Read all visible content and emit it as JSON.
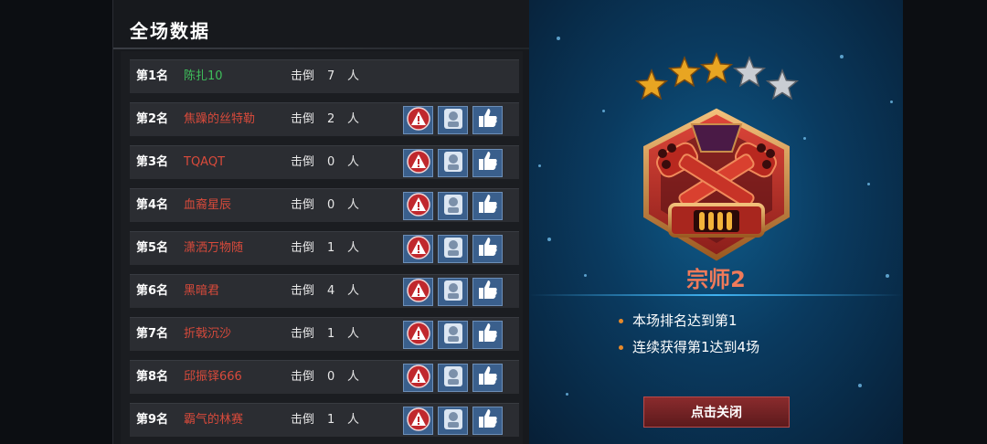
{
  "scoreboard": {
    "title": "全场数据",
    "kill_label": "击倒",
    "unit": "人",
    "rows": [
      {
        "rank": "第1名",
        "name": "陈扎10",
        "kills": "7",
        "name_color": "#3fbf5b",
        "actions": false
      },
      {
        "rank": "第2名",
        "name": "焦躁的丝特勒",
        "kills": "2",
        "name_color": "#d84a3b",
        "actions": true
      },
      {
        "rank": "第3名",
        "name": "TQAQT",
        "kills": "0",
        "name_color": "#d84a3b",
        "actions": true
      },
      {
        "rank": "第4名",
        "name": "血裔星辰",
        "kills": "0",
        "name_color": "#d84a3b",
        "actions": true
      },
      {
        "rank": "第5名",
        "name": "潇洒万物随",
        "kills": "1",
        "name_color": "#d84a3b",
        "actions": true
      },
      {
        "rank": "第6名",
        "name": "黑暗君",
        "kills": "4",
        "name_color": "#d84a3b",
        "actions": true
      },
      {
        "rank": "第7名",
        "name": "折戟沉沙",
        "kills": "1",
        "name_color": "#d84a3b",
        "actions": true
      },
      {
        "rank": "第8名",
        "name": "邱振铎666",
        "kills": "0",
        "name_color": "#d84a3b",
        "actions": true
      },
      {
        "rank": "第9名",
        "name": "霸气的林赛",
        "kills": "1",
        "name_color": "#d84a3b",
        "actions": true
      }
    ],
    "icons": {
      "report": "warning-icon",
      "profile": "profile-icon",
      "like": "thumbs-up-icon"
    }
  },
  "rank_panel": {
    "rank_title": "宗师2",
    "stars_filled": 3,
    "stars_total": 5,
    "achievements": [
      "本场排名达到第1",
      "连续获得第1达到4场"
    ],
    "close_label": "点击关闭"
  },
  "colors": {
    "first_place_name": "#3fbf5b",
    "other_name": "#d84a3b",
    "rank_title": "#f07a5a",
    "button_blue": "#3a5f8c",
    "report_red": "#c0282d",
    "star_gold": "#e8a522",
    "star_silver": "#c9cdd3"
  }
}
